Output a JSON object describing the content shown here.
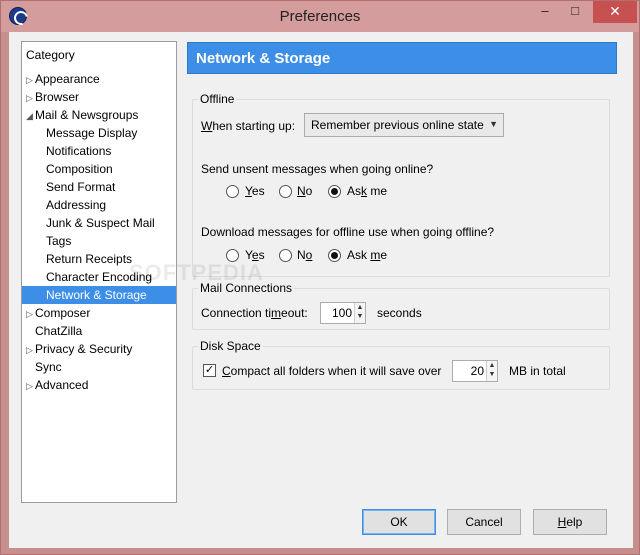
{
  "window": {
    "title": "Preferences"
  },
  "category": {
    "header": "Category",
    "items": [
      {
        "label": "Appearance",
        "arrow": "▷"
      },
      {
        "label": "Browser",
        "arrow": "▷"
      },
      {
        "label": "Mail & Newsgroups",
        "arrow": "◢"
      },
      {
        "label": "Message Display",
        "arrow": ""
      },
      {
        "label": "Notifications",
        "arrow": ""
      },
      {
        "label": "Composition",
        "arrow": ""
      },
      {
        "label": "Send Format",
        "arrow": ""
      },
      {
        "label": "Addressing",
        "arrow": ""
      },
      {
        "label": "Junk & Suspect Mail",
        "arrow": ""
      },
      {
        "label": "Tags",
        "arrow": ""
      },
      {
        "label": "Return Receipts",
        "arrow": ""
      },
      {
        "label": "Character Encoding",
        "arrow": ""
      },
      {
        "label": "Network & Storage",
        "arrow": ""
      },
      {
        "label": "Composer",
        "arrow": "▷"
      },
      {
        "label": "ChatZilla",
        "arrow": ""
      },
      {
        "label": "Privacy & Security",
        "arrow": "▷"
      },
      {
        "label": "Sync",
        "arrow": ""
      },
      {
        "label": "Advanced",
        "arrow": "▷"
      }
    ]
  },
  "panel": {
    "title": "Network & Storage"
  },
  "offline": {
    "group_label": "Offline",
    "startup_prefix": "W",
    "startup_rest": "hen starting up:",
    "startup_value": "Remember previous online state",
    "send_question": "Send unsent messages when going online?",
    "download_question": "Download messages for offline use when going offline?",
    "opt_yes_u": "Y",
    "opt_yes_rest": "es",
    "opt_no_u": "N",
    "opt_no_rest": "o",
    "opt_ask_pre": "As",
    "opt_ask_u": "k",
    "opt_ask_rest": " me",
    "opt_yes2_u": "e",
    "opt_yes2_pre": "Y",
    "opt_yes2_rest": "s",
    "opt_no2_pre": "N",
    "opt_no2_u": "o",
    "opt_ask2_pre": "Ask ",
    "opt_ask2_u": "m",
    "opt_ask2_rest": "e",
    "send_selected": "Ask me",
    "download_selected": "Ask me"
  },
  "mail": {
    "group_label": "Mail Connections",
    "timeout_pre": "Connection ti",
    "timeout_u": "m",
    "timeout_rest": "eout:",
    "timeout_value": "100",
    "units": "seconds"
  },
  "disk": {
    "group_label": "Disk Space",
    "compact_checked": true,
    "compact_u": "C",
    "compact_rest": "ompact all folders when it will save over",
    "compact_value": "20",
    "units": "MB in total"
  },
  "buttons": {
    "ok": "OK",
    "cancel": "Cancel",
    "help_u": "H",
    "help_rest": "elp"
  },
  "watermark": "SOFTPEDIA",
  "colors": {
    "accent": "#3c8ee6",
    "titlebar": "#d49c9c",
    "close": "#c75050"
  }
}
